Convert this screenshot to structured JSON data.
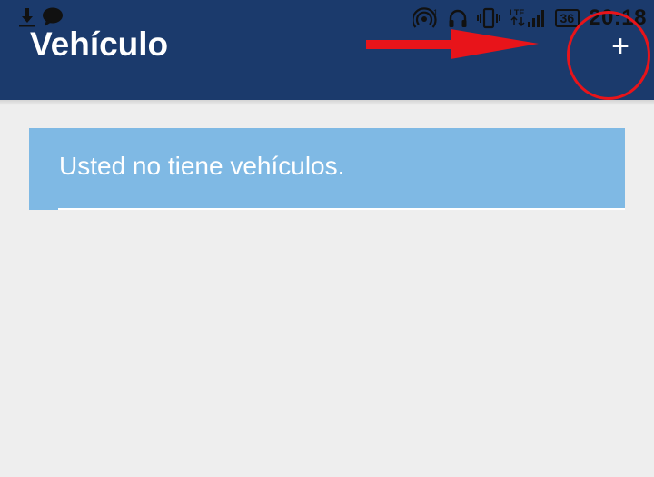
{
  "status_bar": {
    "left_icons": [
      "download-icon",
      "chat-bubble-icon"
    ],
    "right_icons": [
      "hotspot-icon",
      "headphones-icon",
      "vibrate-icon",
      "lte-signal-icon"
    ],
    "network_label": "LTE",
    "battery_level": "36",
    "time": "20:18"
  },
  "app_bar": {
    "title": "Vehículo",
    "add_button_label": "+",
    "background_color": "#1b3a6c"
  },
  "annotation": {
    "arrow_color": "#e8141a",
    "circle_color": "#e8141a"
  },
  "content": {
    "empty_message": "Usted no tiene vehículos.",
    "banner_color": "#7fb9e4"
  }
}
